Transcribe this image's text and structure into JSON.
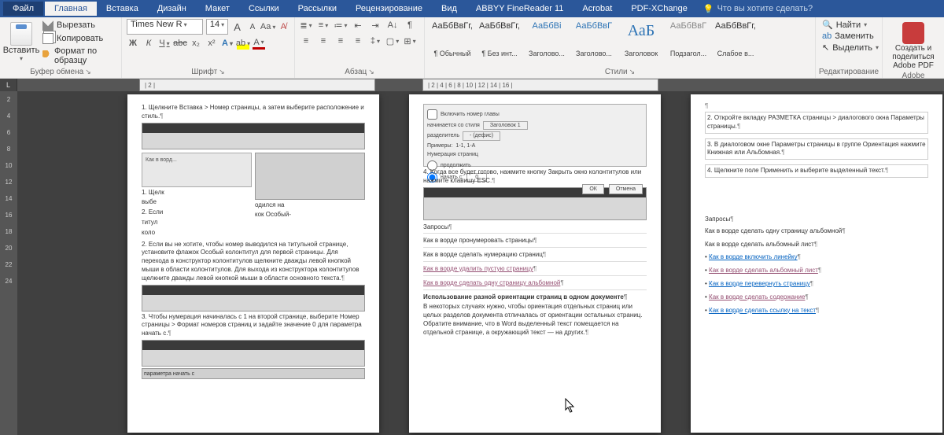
{
  "menu": {
    "file": "Файл",
    "home": "Главная",
    "insert": "Вставка",
    "design": "Дизайн",
    "layout": "Макет",
    "references": "Ссылки",
    "mailings": "Рассылки",
    "review": "Рецензирование",
    "view": "Вид",
    "abbyy": "ABBYY FineReader 11",
    "acrobat": "Acrobat",
    "pdfx": "PDF-XChange",
    "tell_me": "Что вы хотите сделать?"
  },
  "clipboard": {
    "paste": "Вставить",
    "cut": "Вырезать",
    "copy": "Копировать",
    "format_painter": "Формат по образцу",
    "label": "Буфер обмена"
  },
  "font": {
    "name": "Times New R",
    "size": "14",
    "label": "Шрифт",
    "bold": "Ж",
    "italic": "К",
    "underline": "Ч",
    "strike": "abc",
    "sub": "x₂",
    "sup": "x²",
    "case": "Aa",
    "clear": "⌫",
    "color": "A",
    "highlight": "A",
    "grow": "A",
    "shrink": "A"
  },
  "paragraph": {
    "label": "Абзац"
  },
  "styles": {
    "label": "Стили",
    "items": [
      {
        "preview": "АаБбВвГг,",
        "name": "¶ Обычный"
      },
      {
        "preview": "АаБбВвГг,",
        "name": "¶ Без инт..."
      },
      {
        "preview": "АаБбВі",
        "name": "Заголово...",
        "blue": true
      },
      {
        "preview": "АаБбВвГ",
        "name": "Заголово...",
        "blue": true
      },
      {
        "preview": "АаБ",
        "name": "Заголовок",
        "big": true
      },
      {
        "preview": "АаБбВвГ",
        "name": "Подзагол...",
        "gray": true
      },
      {
        "preview": "АаБбВвГг,",
        "name": "Слабое в..."
      }
    ]
  },
  "editing": {
    "find": "Найти",
    "replace": "Заменить",
    "select": "Выделить",
    "label": "Редактирование"
  },
  "adobe": {
    "create": "Создать и поделиться",
    "label": "Adobe PDF",
    "footer": "Adobe"
  },
  "ruler_h": [
    "2",
    "2",
    "4",
    "6",
    "8",
    "10",
    "12",
    "14",
    "16"
  ],
  "ruler_v": [
    "2",
    "4",
    "6",
    "8",
    "10",
    "12",
    "14",
    "16",
    "18",
    "20",
    "22",
    "24"
  ],
  "doc": {
    "p1": {
      "step1": "1. Щелкните Вставка > Номер страницы, а затем выберите расположение и стиль.",
      "step2a": "1. Щелк",
      "step2b": "выбе",
      "step2c": "2. Если",
      "step2d": "титул",
      "step2e": "коло",
      "step2right": "одился на",
      "step2right2": "кок Особый-",
      "step2": "2. Если вы не хотите, чтобы номер выводился на титульной странице, установите флажок Особый колонтитул для первой страницы. Для перехода в конструктор колонтитулов щелкните дважды левой кнопкой мыши в области колонтитулов. Для выхода из конструктора колонтитулов щелкните дважды левой кнопкой мыши в области основного текста.",
      "step3": "3. Чтобы нумерация начиналась с 1 на второй странице, выберите Номер страницы > Формат номеров страниц и задайте значение 0 для параметра начать с."
    },
    "p2": {
      "dlg": {
        "chk": "Включить номер главы",
        "label1": "начинается со стиля",
        "val1": "Заголовок 1",
        "label2": "разделитель",
        "val2": "- (дефис)",
        "label3": "Примеры:",
        "val3": "1-1, 1-А",
        "section": "Нумерация страниц",
        "r1": "продолжить",
        "r2": "начать с:",
        "num": "0",
        "ok": "ОК",
        "cancel": "Отмена"
      },
      "step4": "4. Когда все будет готово, нажмите кнопку Закрыть окно колонтитулов или нажмите клавишу ESC.",
      "links": [
        "Запросы",
        "Как в ворде пронумеровать страницы",
        "Как в ворде сделать нумерацию страниц",
        "Как в ворде удалить пустую страницу",
        "Как в ворде сделать одну страницу альбомной"
      ],
      "heading": "Использование разной ориентации страниц в одном документе",
      "para": "В некоторых случаях нужно, чтобы ориентация отдельных страниц или целых разделов документа отличалась от ориентации остальных страниц. Обратите внимание, что в Word выделенный текст помещается на отдельной странице, а окружающий текст — на других."
    },
    "p3": {
      "step2": "2. Откройте вкладку РАЗМЕТКА страницы > диалогового окна Параметры страницы.",
      "step3": "3. В диалоговом окне Параметры страницы в группе Ориентация нажмите Книжная или Альбомная.",
      "step4": "4. Щелкните поле Применить и выберите выделенный текст.",
      "q": "Запросы",
      "links": [
        "Как в ворде сделать одну страницу альбомной",
        "Как в ворде сделать альбомный лист",
        "Как в ворде включить линейку",
        "Как в ворде сделать альбомный лист",
        "Как в ворде перевернуть страницу",
        "Как в ворде сделать содержание",
        "Как в ворде сделать ссылку на текст"
      ]
    }
  }
}
